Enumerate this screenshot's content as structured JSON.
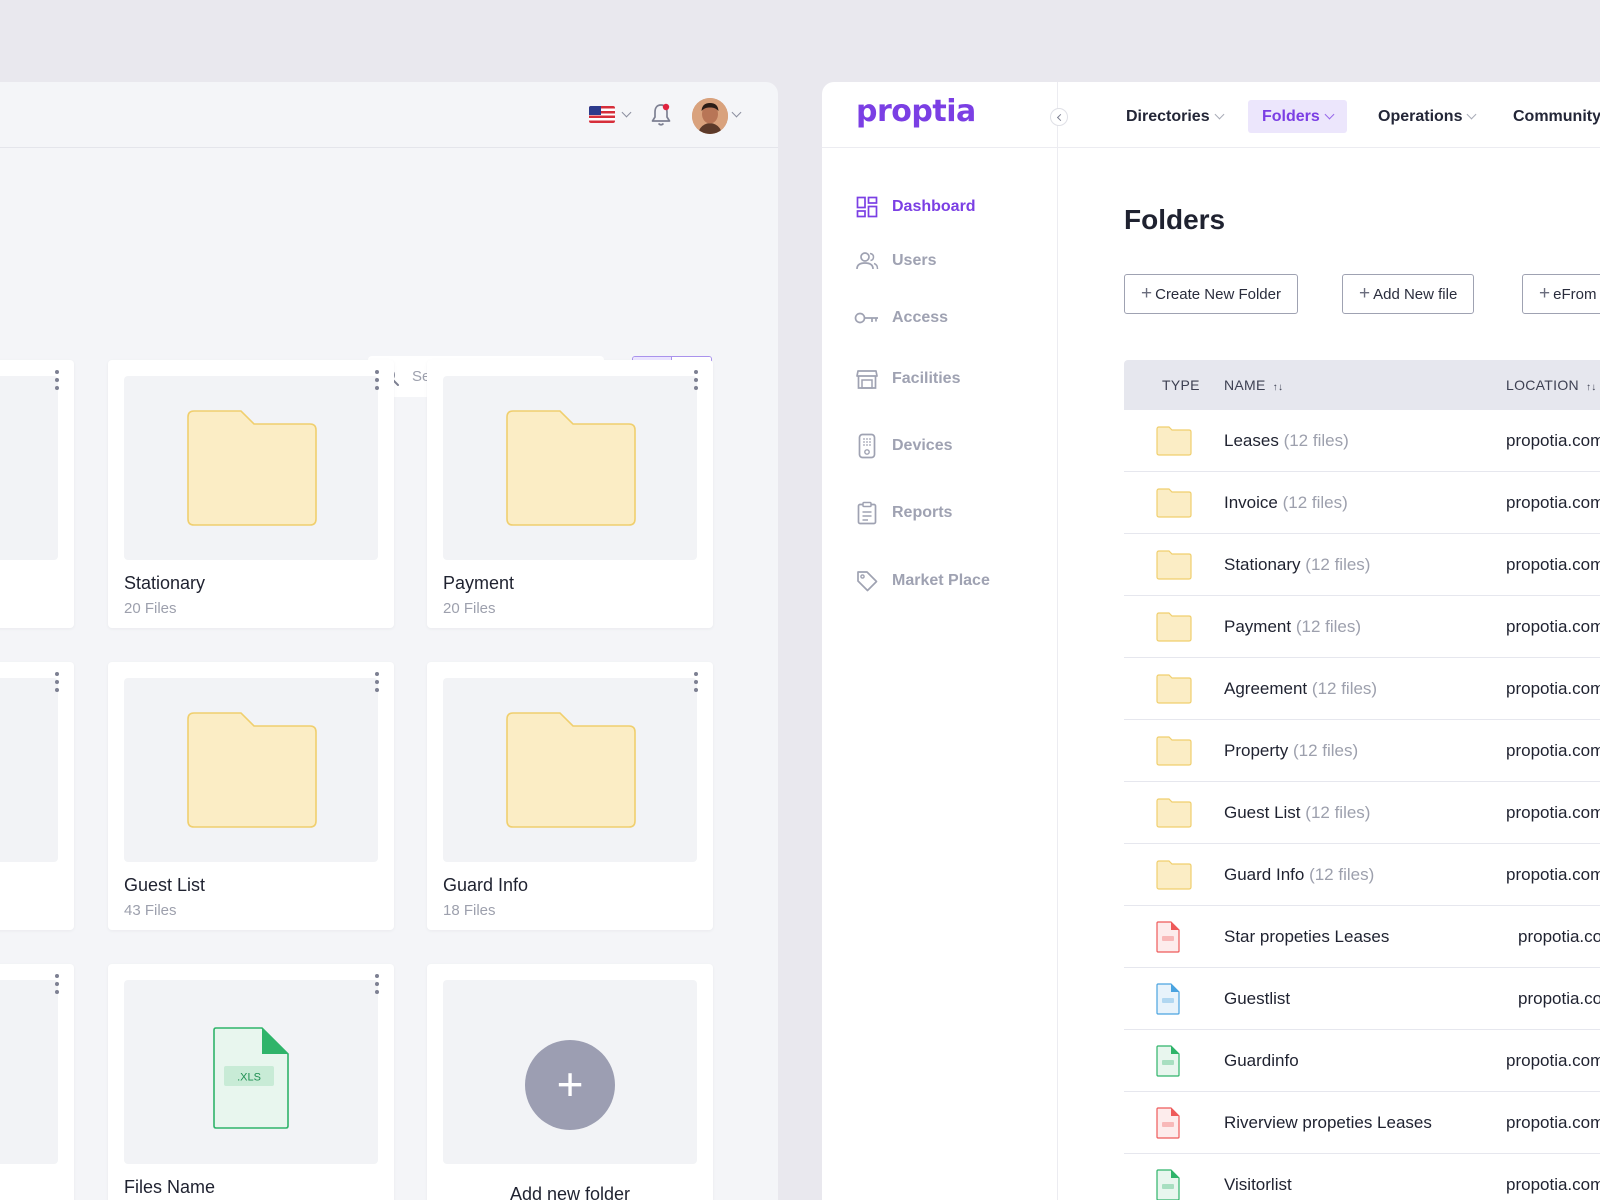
{
  "left": {
    "search": {
      "placeholder": "Search Name"
    },
    "view_toggle": {
      "grid_icon": "grid-icon",
      "list_icon": "list-icon",
      "active": "grid"
    },
    "cards": [
      {
        "name": "Stationary",
        "count": "20 Files",
        "icon": "folder-icon"
      },
      {
        "name": "Payment",
        "count": "20 Files",
        "icon": "folder-icon"
      },
      {
        "name": "Guest List",
        "count": "43 Files",
        "icon": "folder-icon"
      },
      {
        "name": "Guard Info",
        "count": "18 Files",
        "icon": "folder-icon"
      },
      {
        "name": "Files Name",
        "count": "",
        "icon": "xls-file-icon",
        "file_ext": ".XLS"
      }
    ],
    "add_folder": {
      "symbol": "+",
      "label": "Add new folder"
    }
  },
  "right": {
    "logo": "proptia",
    "sidebar": [
      {
        "label": "Dashboard",
        "icon": "dashboard-icon",
        "active": true
      },
      {
        "label": "Users",
        "icon": "users-icon",
        "active": false
      },
      {
        "label": "Access",
        "icon": "key-icon",
        "active": false
      },
      {
        "label": "Facilities",
        "icon": "store-icon",
        "active": false
      },
      {
        "label": "Devices",
        "icon": "device-icon",
        "active": false
      },
      {
        "label": "Reports",
        "icon": "clipboard-icon",
        "active": false
      },
      {
        "label": "Market Place",
        "icon": "tag-icon",
        "active": false
      }
    ],
    "topnav": [
      {
        "label": "Directories",
        "active": false
      },
      {
        "label": "Folders",
        "active": true
      },
      {
        "label": "Operations",
        "active": false
      },
      {
        "label": "Community",
        "active": false
      }
    ],
    "page_title": "Folders",
    "actions": [
      {
        "symbol": "+",
        "label": "Create New Folder"
      },
      {
        "symbol": "+",
        "label": "Add New file"
      },
      {
        "symbol": "+",
        "label": "eFrom"
      }
    ],
    "table": {
      "headers": {
        "type": "TYPE",
        "name": "NAME",
        "location": "LOCATION",
        "sort_symbol": "↑↓"
      },
      "rows": [
        {
          "type": "folder",
          "name": "Leases",
          "count": "(12 files)",
          "location": "propotia.com"
        },
        {
          "type": "folder",
          "name": "Invoice",
          "count": "(12 files)",
          "location": "propotia.com"
        },
        {
          "type": "folder",
          "name": "Stationary",
          "count": "(12 files)",
          "location": "propotia.com"
        },
        {
          "type": "folder",
          "name": "Payment",
          "count": "(12 files)",
          "location": "propotia.com"
        },
        {
          "type": "folder",
          "name": "Agreement",
          "count": "(12 files)",
          "location": "propotia.com"
        },
        {
          "type": "folder",
          "name": "Property",
          "count": "(12 files)",
          "location": "propotia.com"
        },
        {
          "type": "folder",
          "name": "Guest List",
          "count": "(12 files)",
          "location": "propotia.com"
        },
        {
          "type": "folder",
          "name": "Guard Info",
          "count": "(12 files)",
          "location": "propotia.com"
        },
        {
          "type": "pdf",
          "name": "Star propeties Leases",
          "count": "",
          "location": "propotia.com"
        },
        {
          "type": "doc",
          "name": "Guestlist",
          "count": "",
          "location": "propotia.com"
        },
        {
          "type": "xls",
          "name": "Guardinfo",
          "count": "",
          "location": "propotia.com"
        },
        {
          "type": "pdf",
          "name": "Riverview propeties Leases",
          "count": "",
          "location": "propotia.com"
        },
        {
          "type": "xls",
          "name": "Visitorlist",
          "count": "",
          "location": "propotia.com"
        }
      ]
    }
  },
  "colors": {
    "accent": "#7b3fe4",
    "folder_fill": "#fbedc5",
    "folder_stroke": "#f0cf6e",
    "pdf": "#ee5a5a",
    "doc": "#4aa3e0",
    "xls": "#2fb46a"
  }
}
